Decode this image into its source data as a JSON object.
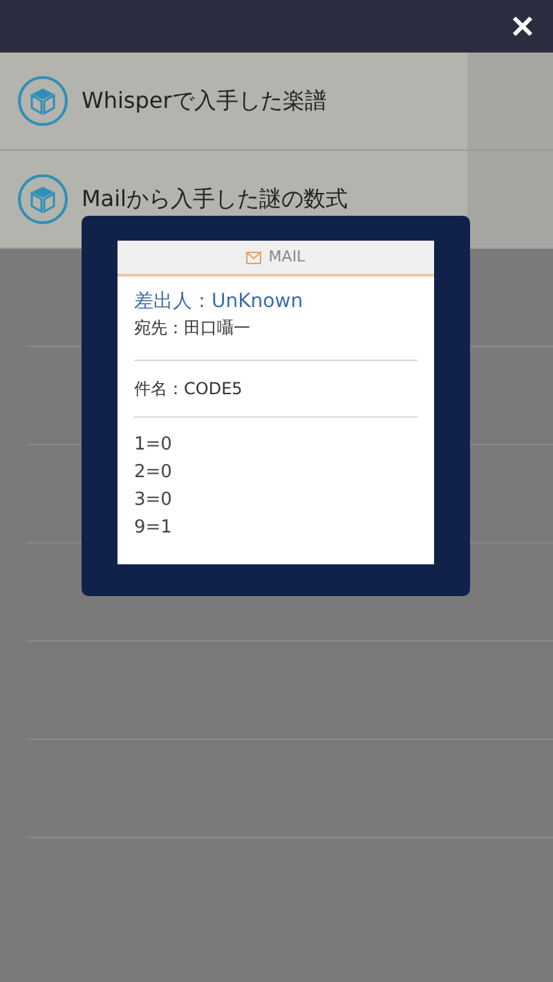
{
  "items": [
    {
      "label": "Whisperで入手した楽譜"
    },
    {
      "label": "Mailから入手した謎の数式"
    }
  ],
  "mail": {
    "header": "MAIL",
    "sender": "差出人：UnKnown",
    "recipient": "宛先：田口囁一",
    "subject": "件名：CODE5",
    "body": [
      "1=0",
      "2=0",
      "3=0",
      "9=1"
    ]
  }
}
